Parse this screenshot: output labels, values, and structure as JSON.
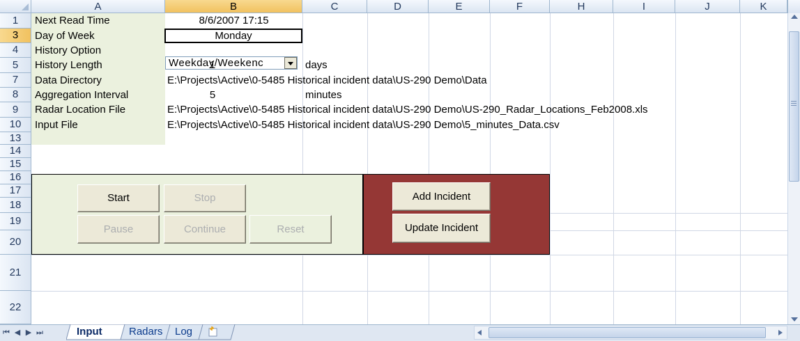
{
  "columns": [
    "A",
    "B",
    "C",
    "D",
    "E",
    "F",
    "H",
    "I",
    "J",
    "K"
  ],
  "rows": [
    "1",
    "3",
    "4",
    "5",
    "7",
    "8",
    "9",
    "10",
    "13",
    "14",
    "15",
    "16",
    "17",
    "18",
    "19",
    "20",
    "21",
    "22"
  ],
  "labels": {
    "next_read_time": "Next Read Time",
    "day_of_week": "Day of Week",
    "history_option": "History Option",
    "history_length": "History Length",
    "data_directory": "Data Directory",
    "aggregation_interval": "Aggregation Interval",
    "radar_location_file": "Radar Location File",
    "input_file": "Input File"
  },
  "values": {
    "next_read_time": "8/6/2007 17:15",
    "day_of_week": "Monday",
    "history_option": "Weekday/Weekenc",
    "history_length": "1",
    "history_length_unit": "days",
    "data_directory": "E:\\Projects\\Active\\0-5485 Historical incident data\\US-290 Demo\\Data",
    "aggregation_interval": "5",
    "aggregation_interval_unit": "minutes",
    "radar_location_file": "E:\\Projects\\Active\\0-5485 Historical incident data\\US-290 Demo\\US-290_Radar_Locations_Feb2008.xls",
    "input_file": "E:\\Projects\\Active\\0-5485 Historical incident data\\US-290 Demo\\5_minutes_Data.csv"
  },
  "buttons": {
    "start": "Start",
    "stop": "Stop",
    "pause": "Pause",
    "continue": "Continue",
    "reset": "Reset",
    "add_incident": "Add Incident",
    "update_incident": "Update Incident"
  },
  "sheet_tabs": [
    "Input",
    "Radars",
    "Log"
  ],
  "active_sheet": "Input",
  "colors": {
    "panel_green": "#ebf1de",
    "panel_red": "#953735",
    "header_selected": "#f1c15f"
  }
}
